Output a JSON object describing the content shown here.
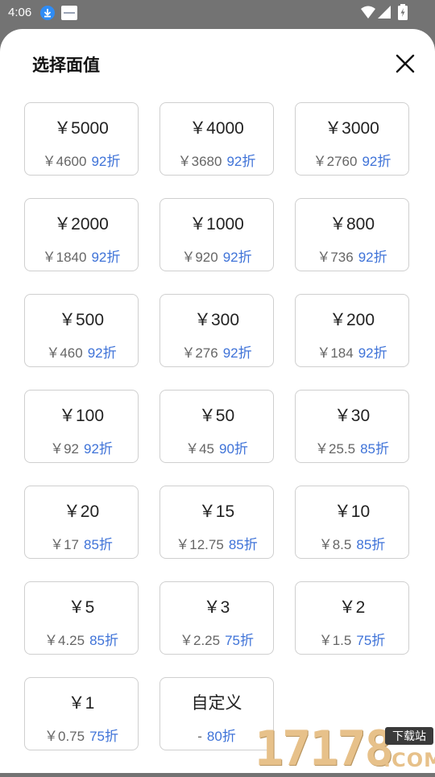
{
  "status_bar": {
    "time": "4:06",
    "icons": [
      "download-icon",
      "image-icon",
      "wifi-icon",
      "signal-icon",
      "battery-icon"
    ]
  },
  "sheet": {
    "title": "选择面值",
    "close_icon": "close-icon"
  },
  "denominations": [
    {
      "face": "￥5000",
      "price": "￥4600",
      "discount": "92折"
    },
    {
      "face": "￥4000",
      "price": "￥3680",
      "discount": "92折"
    },
    {
      "face": "￥3000",
      "price": "￥2760",
      "discount": "92折"
    },
    {
      "face": "￥2000",
      "price": "￥1840",
      "discount": "92折"
    },
    {
      "face": "￥1000",
      "price": "￥920",
      "discount": "92折"
    },
    {
      "face": "￥800",
      "price": "￥736",
      "discount": "92折"
    },
    {
      "face": "￥500",
      "price": "￥460",
      "discount": "92折"
    },
    {
      "face": "￥300",
      "price": "￥276",
      "discount": "92折"
    },
    {
      "face": "￥200",
      "price": "￥184",
      "discount": "92折"
    },
    {
      "face": "￥100",
      "price": "￥92",
      "discount": "92折"
    },
    {
      "face": "￥50",
      "price": "￥45",
      "discount": "90折"
    },
    {
      "face": "￥30",
      "price": "￥25.5",
      "discount": "85折"
    },
    {
      "face": "￥20",
      "price": "￥17",
      "discount": "85折"
    },
    {
      "face": "￥15",
      "price": "￥12.75",
      "discount": "85折"
    },
    {
      "face": "￥10",
      "price": "￥8.5",
      "discount": "85折"
    },
    {
      "face": "￥5",
      "price": "￥4.25",
      "discount": "85折"
    },
    {
      "face": "￥3",
      "price": "￥2.25",
      "discount": "75折"
    },
    {
      "face": "￥2",
      "price": "￥1.5",
      "discount": "75折"
    },
    {
      "face": "￥1",
      "price": "￥0.75",
      "discount": "75折"
    },
    {
      "face": "自定义",
      "price": "-",
      "discount": "80折"
    }
  ],
  "watermark": {
    "digits": "17178",
    "badge": "下载站",
    "suffix": ".COM"
  },
  "colors": {
    "discount": "#3f73d8",
    "card_border": "#cfcfcf",
    "status_bar_bg": "#737373"
  }
}
